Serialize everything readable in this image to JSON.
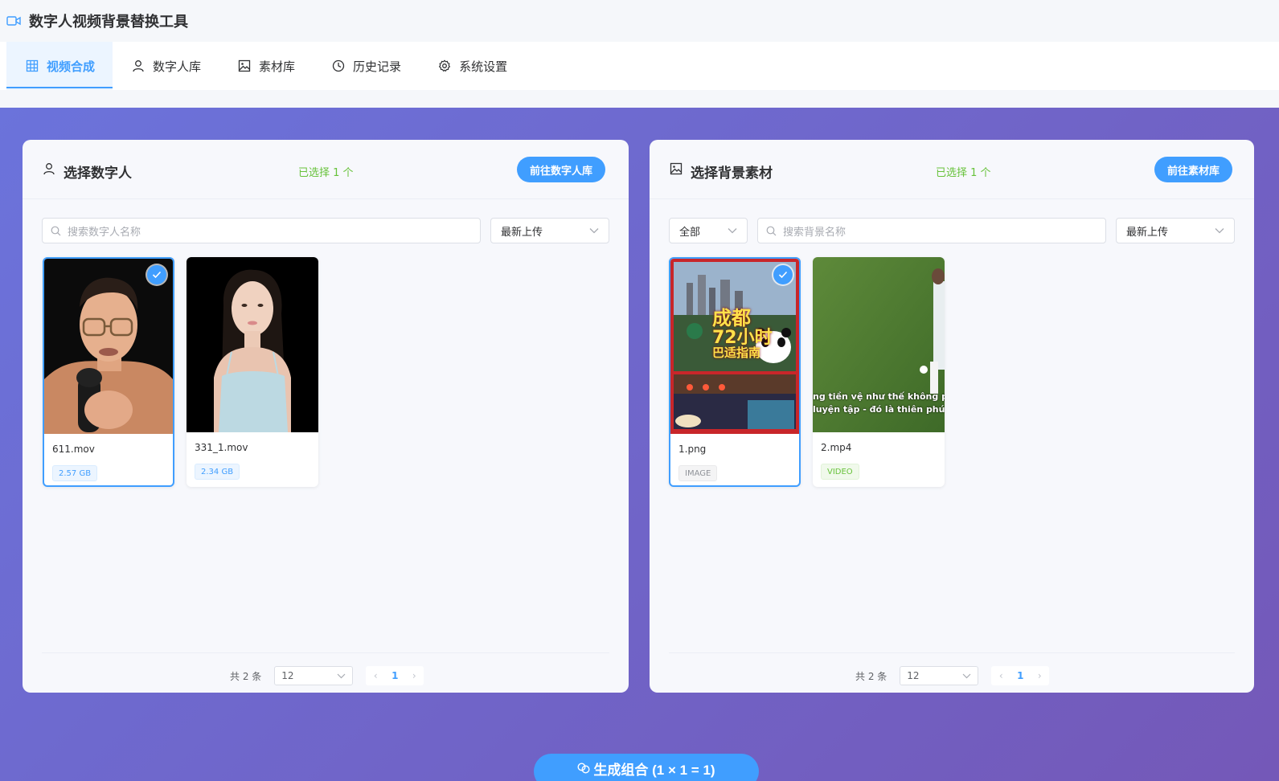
{
  "app": {
    "title": "数字人视频背景替换工具",
    "icon": "video-camera-icon"
  },
  "tabs": [
    {
      "label": "视频合成",
      "icon": "grid-icon",
      "active": true
    },
    {
      "label": "数字人库",
      "icon": "user-icon",
      "active": false
    },
    {
      "label": "素材库",
      "icon": "image-icon",
      "active": false
    },
    {
      "label": "历史记录",
      "icon": "clock-icon",
      "active": false
    },
    {
      "label": "系统设置",
      "icon": "gear-icon",
      "active": false
    }
  ],
  "left_panel": {
    "title": "选择数字人",
    "selected": "已选择 1 个",
    "go_button": "前往数字人库",
    "search_placeholder": "搜索数字人名称",
    "sort": "最新上传",
    "cards": [
      {
        "name": "611.mov",
        "tag": "2.57 GB",
        "selected": true
      },
      {
        "name": "331_1.mov",
        "tag": "2.34 GB",
        "selected": false
      }
    ],
    "pagination": {
      "total": "共 2 条",
      "page_size": "12",
      "current_page": "1"
    }
  },
  "right_panel": {
    "title": "选择背景素材",
    "selected": "已选择 1 个",
    "go_button": "前往素材库",
    "filter": "全部",
    "search_placeholder": "搜索背景名称",
    "sort": "最新上传",
    "cards": [
      {
        "name": "1.png",
        "tag": "IMAGE",
        "selected": true,
        "overlay_lines": [
          "成都",
          "72小时",
          "巴适指南"
        ]
      },
      {
        "name": "2.mp4",
        "tag": "VIDEO",
        "selected": false,
        "overlay_lines": [
          "ng tiền vệ như thế không p",
          "luyện tập - đó là thiên phú."
        ]
      }
    ],
    "pagination": {
      "total": "共 2 条",
      "page_size": "12",
      "current_page": "1"
    }
  },
  "generate_button": "生成组合 (1 × 1 = 1)",
  "colors": {
    "primary": "#409eff",
    "success": "#67c23a",
    "gradient_start": "#6b73db",
    "gradient_end": "#7458b8"
  }
}
